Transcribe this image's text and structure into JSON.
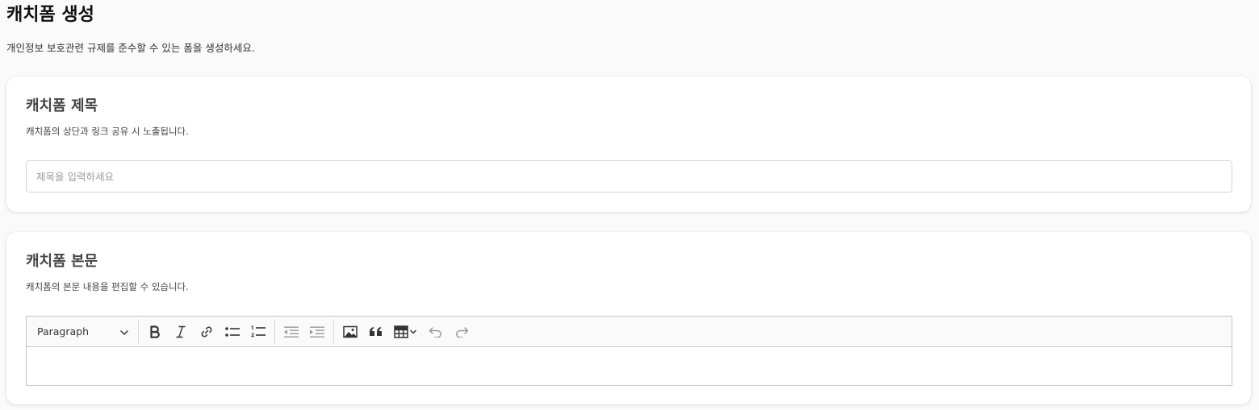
{
  "page": {
    "title": "캐치폼 생성",
    "description": "개인정보 보호관련 규제를 준수할 수 있는 폼을 생성하세요."
  },
  "title_section": {
    "heading": "캐치폼 제목",
    "description": "캐치폼의 상단과 링크 공유 시 노출됩니다.",
    "input_placeholder": "제목을 입력하세요",
    "input_value": ""
  },
  "body_section": {
    "heading": "캐치폼 본문",
    "description": "캐치폼의 본문 내용을 편집할 수 있습니다.",
    "editor": {
      "heading_select": "Paragraph",
      "content": "",
      "toolbar_icons": [
        "bold-icon",
        "italic-icon",
        "link-icon",
        "bulleted-list-icon",
        "numbered-list-icon",
        "outdent-icon",
        "indent-icon",
        "image-icon",
        "blockquote-icon",
        "table-icon",
        "undo-icon",
        "redo-icon"
      ]
    }
  },
  "colors": {
    "background": "#fafafa",
    "card": "#ffffff",
    "heading_text": "#444444",
    "border": "#c4c4c4",
    "disabled_icon": "#9a9a9a"
  }
}
